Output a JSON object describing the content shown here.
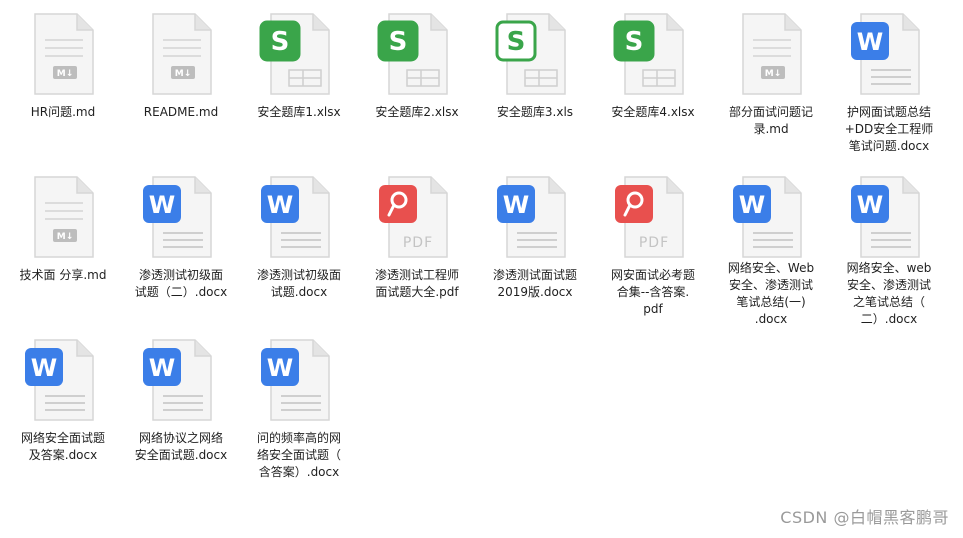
{
  "files": [
    {
      "label": "HR问题.md",
      "type": "md"
    },
    {
      "label": "README.md",
      "type": "md"
    },
    {
      "label": "安全题库1.xlsx",
      "type": "xlsx"
    },
    {
      "label": "安全题库2.xlsx",
      "type": "xlsx"
    },
    {
      "label": "安全题库3.xls",
      "type": "xls"
    },
    {
      "label": "安全题库4.xlsx",
      "type": "xlsx"
    },
    {
      "label": "部分面试问题记\n录.md",
      "type": "md"
    },
    {
      "label": "护网面试题总结\n+DD安全工程师\n笔试问题.docx",
      "type": "docx"
    },
    {
      "label": "技术面 分享.md",
      "type": "md"
    },
    {
      "label": "渗透测试初级面\n试题（二）.docx",
      "type": "docx"
    },
    {
      "label": "渗透测试初级面\n试题.docx",
      "type": "docx"
    },
    {
      "label": "渗透测试工程师\n面试题大全.pdf",
      "type": "pdf"
    },
    {
      "label": "渗透测试面试题\n2019版.docx",
      "type": "docx"
    },
    {
      "label": "网安面试必考题\n合集--含答案.\npdf",
      "type": "pdf"
    },
    {
      "label": "网络安全、Web\n安全、渗透测试\n笔试总结(一)\n.docx",
      "type": "docx"
    },
    {
      "label": "网络安全、web\n安全、渗透测试\n之笔试总结（\n二）.docx",
      "type": "docx"
    },
    {
      "label": "网络安全面试题\n及答案.docx",
      "type": "docx"
    },
    {
      "label": "网络协议之网络\n安全面试题.docx",
      "type": "docx"
    },
    {
      "label": "问的频率高的网\n络安全面试题（\n含答案）.docx",
      "type": "docx"
    }
  ],
  "icons": {
    "md": {
      "name": "markdown-file-icon",
      "badge": "M↓"
    },
    "xlsx": {
      "name": "spreadsheet-file-icon",
      "letter": "S",
      "color": "#3aa54a"
    },
    "xls": {
      "name": "spreadsheet-file-icon",
      "letter": "S",
      "color": "#3aa54a"
    },
    "docx": {
      "name": "word-file-icon",
      "letter": "W",
      "color": "#3b7ee8"
    },
    "pdf": {
      "name": "pdf-file-icon",
      "letter": "PDF",
      "color": "#e8504e"
    }
  },
  "watermark": "CSDN @白帽黑客鹏哥"
}
